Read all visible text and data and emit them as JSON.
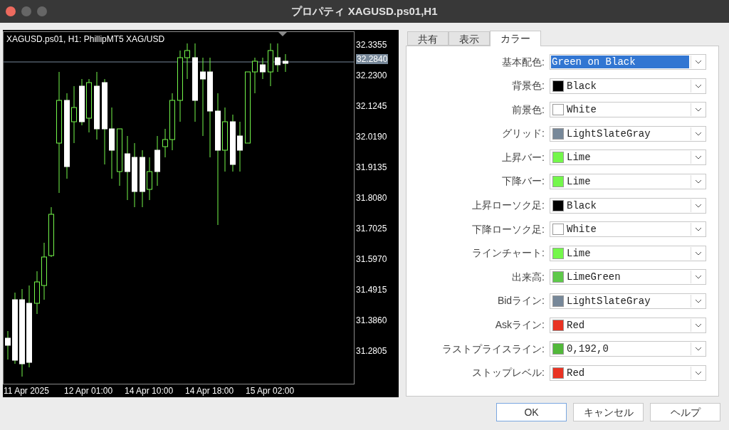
{
  "window": {
    "title": "プロパティ XAGUSD.ps01,H1"
  },
  "chart": {
    "legend": "XAGUSD.ps01, H1:  PhillipMT5 XAG/USD",
    "price_labels": [
      "32.3355",
      "32.2300",
      "32.1245",
      "32.0190",
      "31.9135",
      "31.8080",
      "31.7025",
      "31.5970",
      "31.4915",
      "31.3860",
      "31.2805"
    ],
    "current_price": "32.2840",
    "time_labels": [
      "11 Apr 2025",
      "12 Apr 01:00",
      "14 Apr 10:00",
      "14 Apr 18:00",
      "15 Apr 02:00"
    ]
  },
  "tabs": [
    {
      "label": "共有",
      "selected": false
    },
    {
      "label": "表示",
      "selected": false
    },
    {
      "label": "カラー",
      "selected": true
    }
  ],
  "scheme": {
    "label": "基本配色:",
    "value": "Green on Black"
  },
  "colors": [
    {
      "label": "背景色:",
      "value": "Black",
      "color": "#000000"
    },
    {
      "label": "前景色:",
      "value": "White",
      "color": "#ffffff"
    },
    {
      "label": "グリッド:",
      "value": "LightSlateGray",
      "color": "#778899"
    },
    {
      "label": "上昇バー:",
      "value": "Lime",
      "color": "#74f74b"
    },
    {
      "label": "下降バー:",
      "value": "Lime",
      "color": "#74f74b"
    },
    {
      "label": "上昇ローソク足:",
      "value": "Black",
      "color": "#000000"
    },
    {
      "label": "下降ローソク足:",
      "value": "White",
      "color": "#ffffff"
    },
    {
      "label": "ラインチャート:",
      "value": "Lime",
      "color": "#74f74b"
    },
    {
      "label": "出来高:",
      "value": "LimeGreen",
      "color": "#5ec94a"
    },
    {
      "label": "Bidライン:",
      "value": "LightSlateGray",
      "color": "#778899"
    },
    {
      "label": "Askライン:",
      "value": "Red",
      "color": "#e93323"
    },
    {
      "label": "ラストプライスライン:",
      "value": "0,192,0",
      "color": "#52b83a"
    },
    {
      "label": "ストップレベル:",
      "value": "Red",
      "color": "#e93323"
    }
  ],
  "buttons": [
    "OK",
    "キャンセル",
    "ヘルプ"
  ]
}
